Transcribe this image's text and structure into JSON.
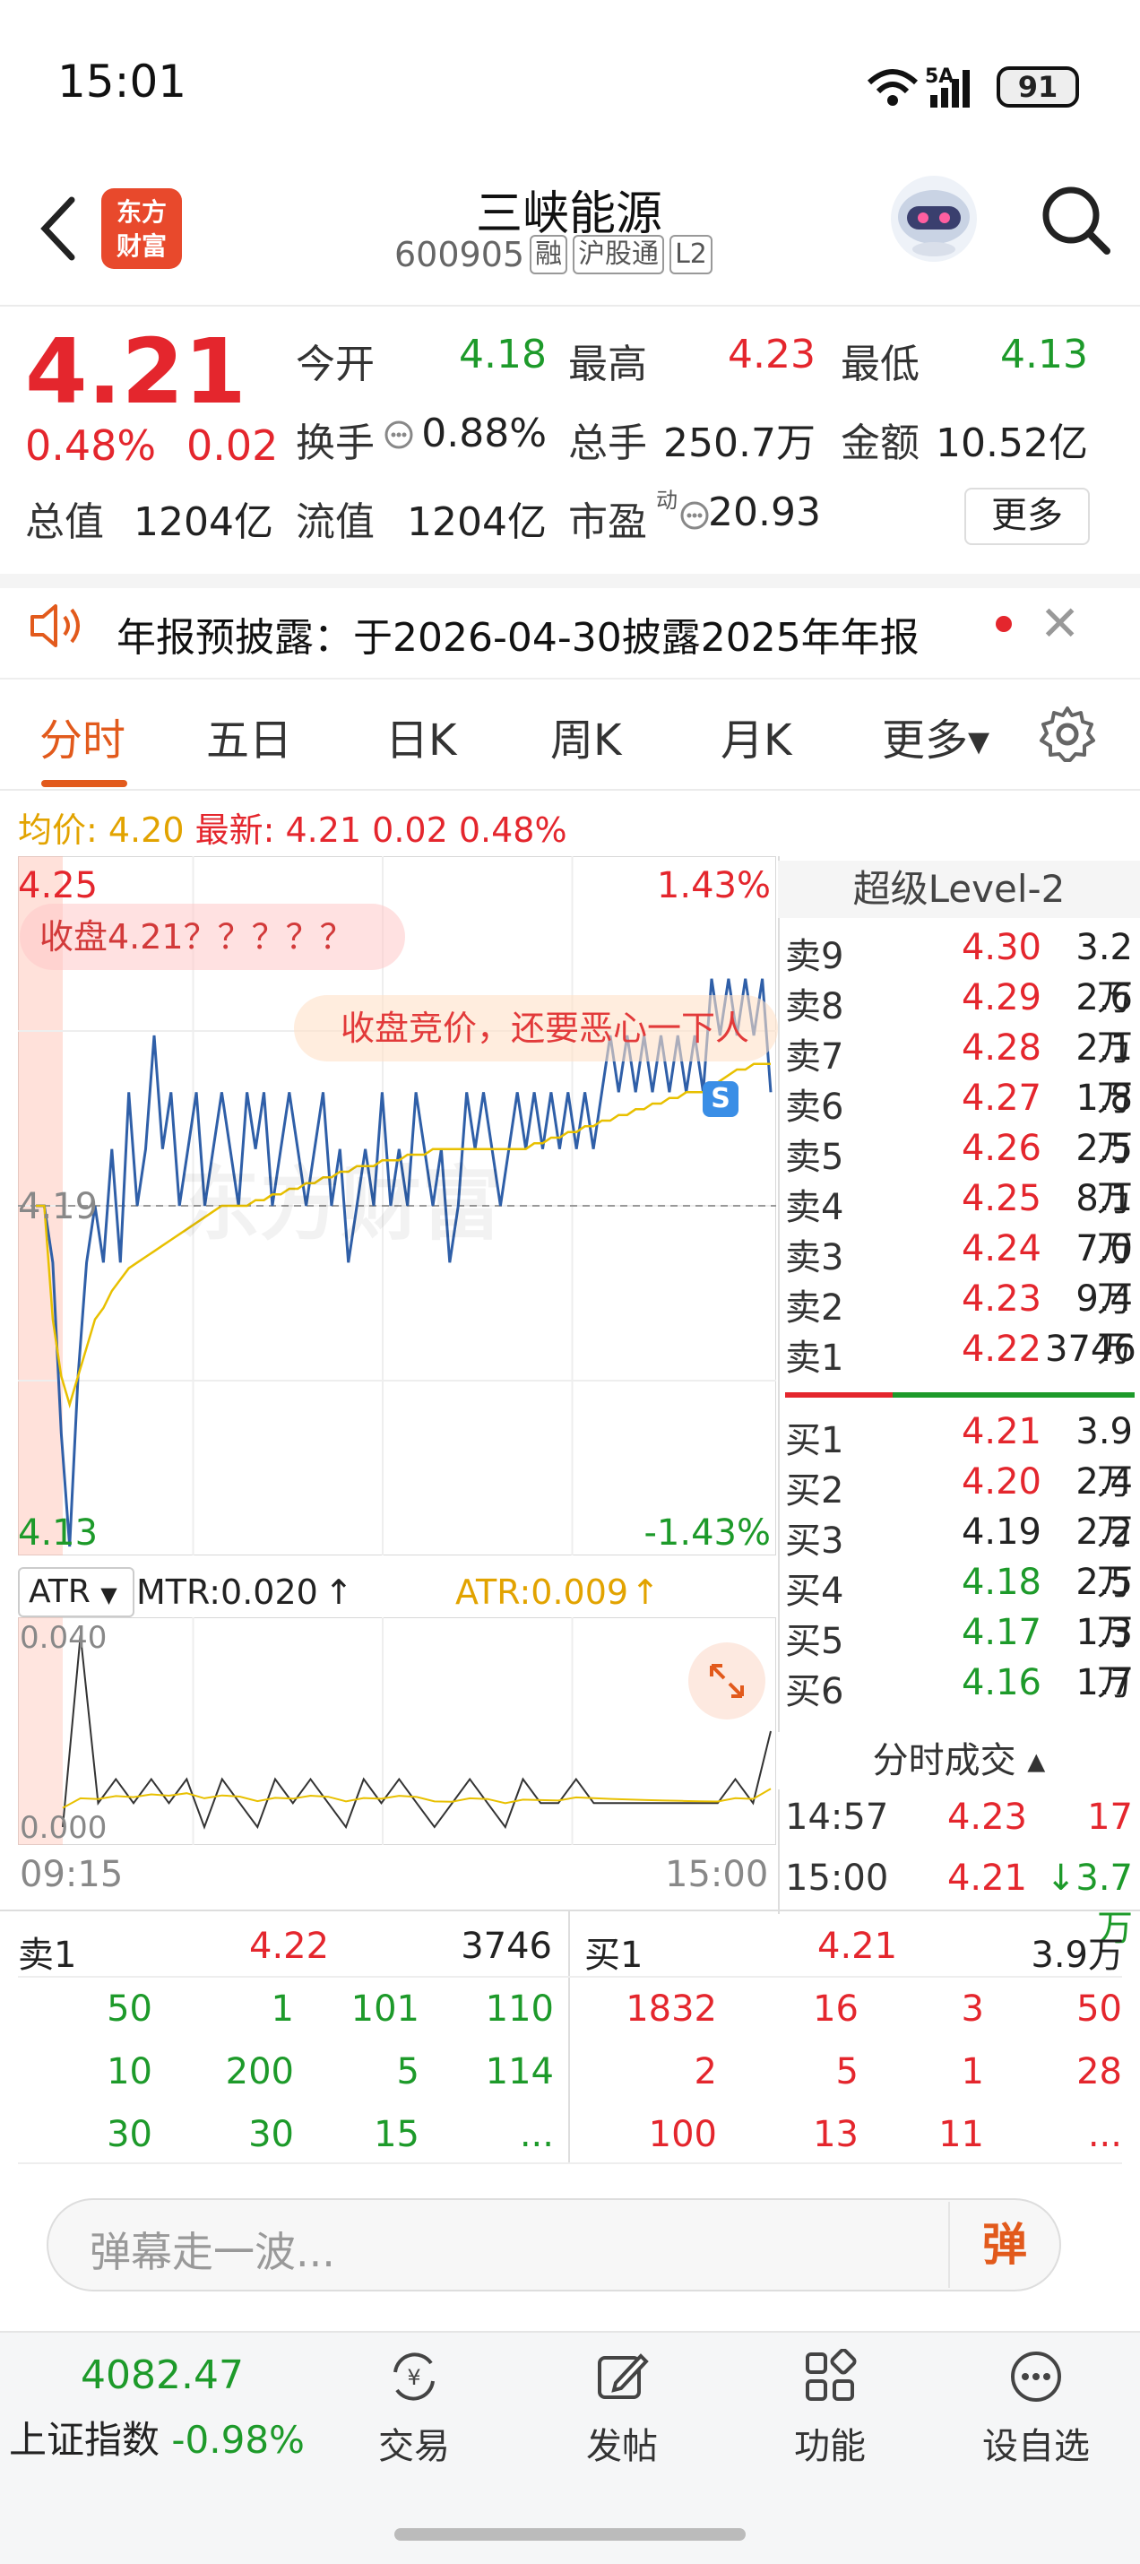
{
  "status_bar": {
    "time": "15:01",
    "network": "5A",
    "battery": "91"
  },
  "header": {
    "logo_line1": "东方",
    "logo_line2": "财富",
    "stock_name": "三峡能源",
    "stock_code": "600905",
    "tags": [
      "融",
      "沪股通",
      "L2"
    ]
  },
  "quote": {
    "price": "4.21",
    "change_pct": "0.48%",
    "change_val": "0.02",
    "fields": [
      {
        "label": "今开",
        "value": "4.18",
        "color": "#1d9a2a"
      },
      {
        "label": "最高",
        "value": "4.23",
        "color": "#e4262d"
      },
      {
        "label": "最低",
        "value": "4.13",
        "color": "#1d9a2a"
      },
      {
        "label": "换手",
        "value": "0.88%",
        "color": "#222222"
      },
      {
        "label": "总手",
        "value": "250.7万",
        "color": "#222222"
      },
      {
        "label": "金额",
        "value": "10.52亿",
        "color": "#222222"
      }
    ],
    "total_value_label": "总值",
    "total_value": "1204亿",
    "float_value_label": "流值",
    "float_value": "1204亿",
    "pe_label": "市盈",
    "pe_sup": "动",
    "pe_value": "20.93",
    "more_button": "更多"
  },
  "notice": {
    "text": "年报预披露：于2026-04-30披露2025年年报"
  },
  "tabs": [
    "分时",
    "五日",
    "日K",
    "周K",
    "月K",
    "更多▾"
  ],
  "legend": {
    "avg_label": "均价: 4.20",
    "latest_label": "最新: 4.21 0.02 0.48%"
  },
  "chart_data": {
    "type": "line",
    "title": "",
    "xlabel": "",
    "ylabel": "",
    "ylim": [
      4.13,
      4.25
    ],
    "y_top_label": "4.25",
    "y_mid_label": "4.19",
    "y_bottom_label": "4.13",
    "pct_top_label": "1.43%",
    "pct_bottom_label": "-1.43%",
    "prev_close": 4.19,
    "x_start_label": "09:15",
    "x_end_label": "15:00",
    "series": [
      {
        "name": "最新",
        "color": "#2f5fa8",
        "values": [
          4.19,
          4.19,
          4.18,
          4.15,
          4.13,
          4.16,
          4.18,
          4.19,
          4.18,
          4.2,
          4.18,
          4.21,
          4.19,
          4.2,
          4.22,
          4.2,
          4.21,
          4.19,
          4.2,
          4.21,
          4.19,
          4.2,
          4.21,
          4.2,
          4.19,
          4.21,
          4.2,
          4.21,
          4.19,
          4.2,
          4.21,
          4.2,
          4.19,
          4.2,
          4.21,
          4.19,
          4.2,
          4.18,
          4.19,
          4.2,
          4.19,
          4.21,
          4.19,
          4.2,
          4.19,
          4.21,
          4.2,
          4.19,
          4.2,
          4.18,
          4.19,
          4.21,
          4.2,
          4.21,
          4.2,
          4.19,
          4.2,
          4.21,
          4.2,
          4.21,
          4.2,
          4.21,
          4.2,
          4.21,
          4.2,
          4.21,
          4.2,
          4.21,
          4.22,
          4.21,
          4.22,
          4.21,
          4.22,
          4.21,
          4.22,
          4.21,
          4.22,
          4.21,
          4.22,
          4.21,
          4.23,
          4.22,
          4.23,
          4.22,
          4.23,
          4.22,
          4.23,
          4.21
        ]
      },
      {
        "name": "均价",
        "color": "#e8c000",
        "values": [
          4.19,
          4.19,
          4.17,
          4.16,
          4.155,
          4.16,
          4.165,
          4.17,
          4.172,
          4.175,
          4.177,
          4.179,
          4.18,
          4.181,
          4.182,
          4.183,
          4.184,
          4.185,
          4.186,
          4.187,
          4.188,
          4.189,
          4.19,
          4.19,
          4.19,
          4.19,
          4.191,
          4.191,
          4.192,
          4.192,
          4.193,
          4.193,
          4.194,
          4.194,
          4.195,
          4.195,
          4.196,
          4.196,
          4.197,
          4.197,
          4.197,
          4.198,
          4.198,
          4.198,
          4.199,
          4.199,
          4.199,
          4.2,
          4.2,
          4.2,
          4.2,
          4.2,
          4.2,
          4.2,
          4.2,
          4.2,
          4.2,
          4.2,
          4.2,
          4.201,
          4.201,
          4.202,
          4.202,
          4.203,
          4.203,
          4.204,
          4.204,
          4.205,
          4.205,
          4.206,
          4.206,
          4.207,
          4.207,
          4.208,
          4.208,
          4.209,
          4.209,
          4.21,
          4.21,
          4.21,
          4.211,
          4.212,
          4.213,
          4.214,
          4.214,
          4.215,
          4.215,
          4.215
        ]
      }
    ]
  },
  "annotations": {
    "bubble1": "收盘4.21？？？？？",
    "bubble2": "收盘竞价，还要恶心一下人",
    "marker": "S",
    "watermark": "东方财富"
  },
  "indicator": {
    "name": "ATR",
    "mtr_label": "MTR:0.020",
    "atr_label": "ATR:0.009",
    "y_top": "0.040",
    "y_bottom": "0.000",
    "mtr_values": [
      0.0,
      0.04,
      0.005,
      0.01,
      0.005,
      0.01,
      0.005,
      0.01,
      0.0,
      0.01,
      0.005,
      0.0,
      0.01,
      0.005,
      0.01,
      0.005,
      0.0,
      0.01,
      0.005,
      0.01,
      0.005,
      0.0,
      0.005,
      0.01,
      0.005,
      0.0,
      0.01,
      0.005,
      0.005,
      0.01,
      0.005,
      0.005,
      0.005,
      0.005,
      0.005,
      0.005,
      0.005,
      0.005,
      0.01,
      0.005,
      0.02
    ]
  },
  "level2": {
    "title": "超级Level-2",
    "asks": [
      {
        "label": "卖9",
        "price": "4.30",
        "vol": "3.2万"
      },
      {
        "label": "卖8",
        "price": "4.29",
        "vol": "2.6万"
      },
      {
        "label": "卖7",
        "price": "4.28",
        "vol": "2.1万"
      },
      {
        "label": "卖6",
        "price": "4.27",
        "vol": "1.8万"
      },
      {
        "label": "卖5",
        "price": "4.26",
        "vol": "2.5万"
      },
      {
        "label": "卖4",
        "price": "4.25",
        "vol": "8.1万"
      },
      {
        "label": "卖3",
        "price": "4.24",
        "vol": "7.0万"
      },
      {
        "label": "卖2",
        "price": "4.23",
        "vol": "9.4万"
      },
      {
        "label": "卖1",
        "price": "4.22",
        "vol": "3746"
      }
    ],
    "bids": [
      {
        "label": "买1",
        "price": "4.21",
        "vol": "3.9万",
        "color": "#e4262d"
      },
      {
        "label": "买2",
        "price": "4.20",
        "vol": "2.4万",
        "color": "#e4262d"
      },
      {
        "label": "买3",
        "price": "4.19",
        "vol": "2.2万",
        "color": "#222222"
      },
      {
        "label": "买4",
        "price": "4.18",
        "vol": "2.5万",
        "color": "#1d9a2a"
      },
      {
        "label": "买5",
        "price": "4.17",
        "vol": "1.3万",
        "color": "#1d9a2a"
      },
      {
        "label": "买6",
        "price": "4.16",
        "vol": "1.7万",
        "color": "#1d9a2a"
      }
    ],
    "trades_title": "分时成交 ▴",
    "trades": [
      {
        "time": "14:57",
        "price": "4.23",
        "vol": "17",
        "vol_color": "#e4262d"
      },
      {
        "time": "15:00",
        "price": "4.21",
        "vol": "↓3.7万",
        "vol_color": "#1d9a2a"
      }
    ]
  },
  "queue": {
    "ask_label": "卖1",
    "ask_price": "4.22",
    "ask_vol": "3746",
    "bid_label": "买1",
    "bid_price": "4.21",
    "bid_vol": "3.9万",
    "ask_orders": [
      [
        "50",
        "1",
        "101",
        "110"
      ],
      [
        "10",
        "200",
        "5",
        "114"
      ],
      [
        "30",
        "30",
        "15",
        "..."
      ]
    ],
    "bid_orders": [
      [
        "1832",
        "16",
        "3",
        "50"
      ],
      [
        "2",
        "5",
        "1",
        "28"
      ],
      [
        "100",
        "13",
        "11",
        "..."
      ]
    ]
  },
  "danmaku": {
    "placeholder": "弹幕走一波...",
    "button": "弹"
  },
  "bottom_nav": {
    "index_value": "4082.47",
    "index_name": "上证指数",
    "index_change": "-0.98%",
    "items": [
      "交易",
      "发帖",
      "功能",
      "设自选"
    ]
  }
}
